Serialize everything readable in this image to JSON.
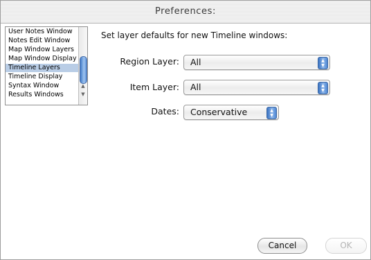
{
  "window": {
    "title": "Preferences:"
  },
  "sidebar": {
    "items": [
      {
        "label": "User Notes Window",
        "selected": false
      },
      {
        "label": "Notes Edit Window",
        "selected": false
      },
      {
        "label": "Map Window Layers",
        "selected": false
      },
      {
        "label": "Map Window Display",
        "selected": false
      },
      {
        "label": "Timeline Layers",
        "selected": true
      },
      {
        "label": "Timeline Display",
        "selected": false
      },
      {
        "label": "Syntax Window",
        "selected": false
      },
      {
        "label": "Results Windows",
        "selected": false
      }
    ]
  },
  "panel": {
    "heading": "Set layer defaults for new Timeline windows:",
    "region_layer": {
      "label": "Region Layer:",
      "value": "All"
    },
    "item_layer": {
      "label": "Item Layer:",
      "value": "All"
    },
    "dates": {
      "label": "Dates:",
      "value": "Conservative"
    }
  },
  "buttons": {
    "cancel": "Cancel",
    "ok": "OK"
  },
  "colors": {
    "selection": "#b9cde6",
    "accent_blue": "#3a73c2"
  }
}
